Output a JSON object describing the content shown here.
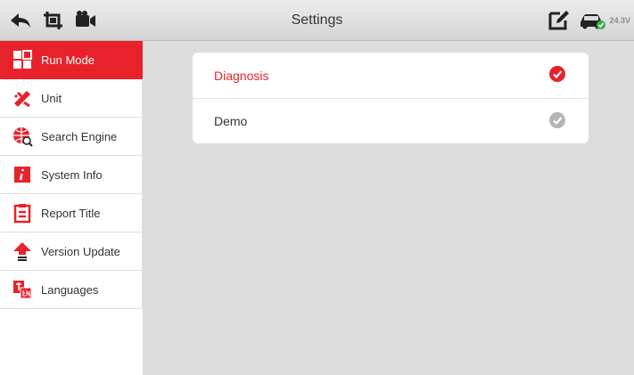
{
  "header": {
    "title": "Settings",
    "voltage": "24.3V",
    "icons": [
      "back-icon",
      "screenshot-icon",
      "video-record-icon",
      "feedback-edit-icon",
      "vci-car-icon"
    ]
  },
  "sidebar": {
    "items": [
      {
        "label": "Run Mode",
        "icon": "run-mode-icon",
        "active": true
      },
      {
        "label": "Unit",
        "icon": "unit-icon",
        "active": false
      },
      {
        "label": "Search Engine",
        "icon": "search-engine-icon",
        "active": false
      },
      {
        "label": "System Info",
        "icon": "system-info-icon",
        "active": false
      },
      {
        "label": "Report Title",
        "icon": "report-title-icon",
        "active": false
      },
      {
        "label": "Version Update",
        "icon": "version-update-icon",
        "active": false
      },
      {
        "label": "Languages",
        "icon": "languages-icon",
        "active": false
      }
    ]
  },
  "main": {
    "options": [
      {
        "label": "Diagnosis",
        "selected": true
      },
      {
        "label": "Demo",
        "selected": false
      }
    ]
  },
  "colors": {
    "accent": "#e8222b",
    "topbar": "#dcdcdc",
    "content_bg": "#dcdcdc",
    "check_inactive": "#b5b5b5",
    "battery_ok": "#2fb34a"
  }
}
